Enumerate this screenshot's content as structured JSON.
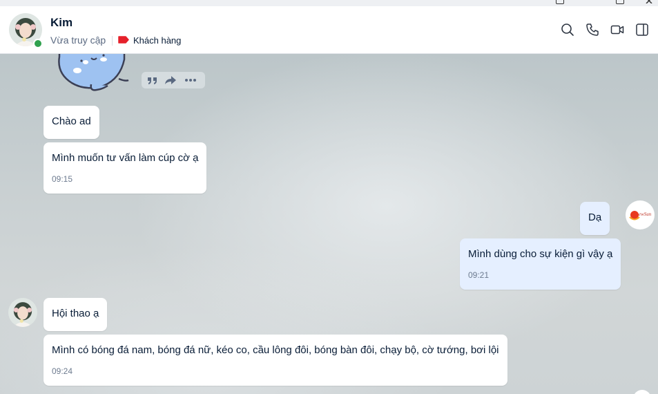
{
  "contact": {
    "name": "Kim",
    "status": "Vừa truy cập",
    "tag_label": "Khách hàng",
    "tag_color": "#e5202b",
    "online_color": "#30a14e"
  },
  "header_icons": [
    "search-icon",
    "phone-icon",
    "video-call-icon",
    "sidebar-toggle-icon"
  ],
  "message_actions": [
    "quote-icon",
    "forward-icon",
    "more-icon"
  ],
  "messages": [
    {
      "text": "Chào ad",
      "time": ""
    },
    {
      "text": "Mình muốn tư vấn làm cúp cờ ạ",
      "time": "09:15"
    },
    {
      "text": "Dạ",
      "time": ""
    },
    {
      "text": "Mình dùng cho sự kiện gì vậy ạ",
      "time": "09:21"
    },
    {
      "text": "Hội thao ạ",
      "time": ""
    },
    {
      "text": "Mình có bóng đá nam, bóng đá nữ, kéo co, cầu lông đôi, bóng bàn đôi, chạy bộ, cờ tướng, bơi lội",
      "time": "09:24"
    }
  ],
  "shop_logo_text": "ewSun"
}
